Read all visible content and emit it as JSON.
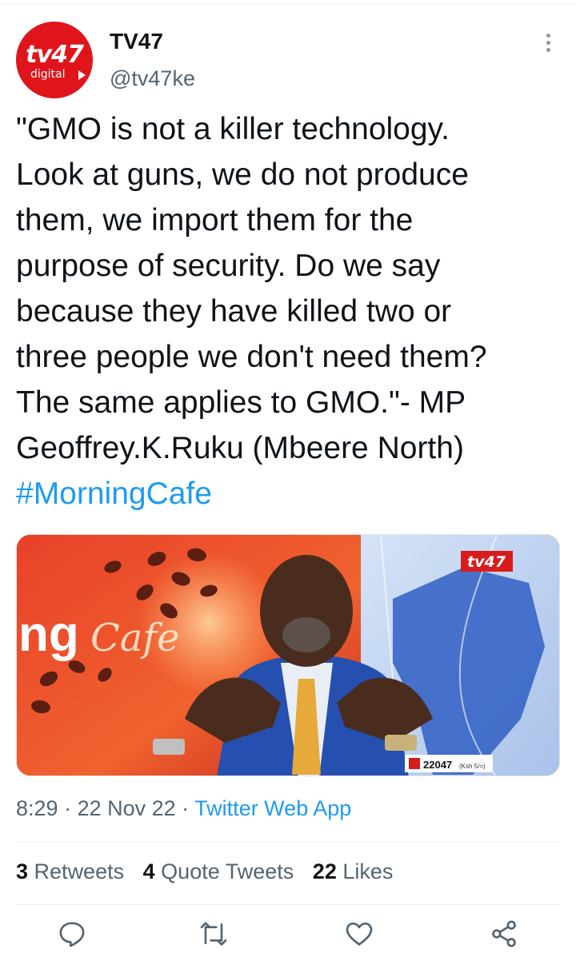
{
  "account": {
    "name": "TV47",
    "handle": "@tv47ke",
    "avatar_logo": "tv47",
    "avatar_sub": "digital"
  },
  "tweet": {
    "lines": [
      "\"GMO is not a killer technology.",
      "Look at guns, we do not produce",
      "them, we import them for the",
      "purpose of security. Do we say",
      "because they have killed two or",
      "three people we don't need them?",
      "The same applies to GMO.\"- MP",
      "Geoffrey.K.Ruku (Mbeere North)"
    ],
    "hashtag": "#MorningCafe"
  },
  "media": {
    "banner_text": "ng",
    "banner_script": "Cafe",
    "channel_logo": "tv47",
    "ticker_value": "22047",
    "ticker_unit": "(Ksh 5/=)"
  },
  "meta": {
    "time": "8:29",
    "sep1": " · ",
    "date": "22 Nov 22",
    "sep2": " · ",
    "source": "Twitter Web App"
  },
  "stats": {
    "retweets_count": "3",
    "retweets_label": "Retweets",
    "quotes_count": "4",
    "quotes_label": "Quote Tweets",
    "likes_count": "22",
    "likes_label": "Likes"
  },
  "icons": {
    "reply": "reply-icon",
    "retweet": "retweet-icon",
    "like": "heart-icon",
    "share": "share-icon",
    "more": "more-icon"
  },
  "colors": {
    "accent": "#1d9bf0",
    "brand_red": "#e0151c",
    "muted": "#536471"
  }
}
